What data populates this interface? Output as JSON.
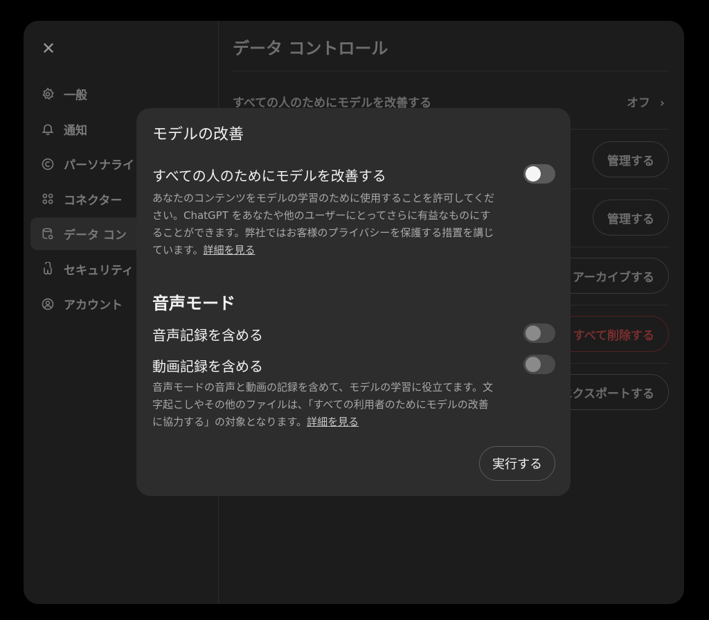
{
  "sidebar": {
    "close_glyph": "✕",
    "items": [
      {
        "label": "一般",
        "icon": "gear-icon"
      },
      {
        "label": "通知",
        "icon": "bell-icon"
      },
      {
        "label": "パーソナライ",
        "icon": "personalize-icon"
      },
      {
        "label": "コネクター",
        "icon": "connector-icon"
      },
      {
        "label": "データ コン",
        "icon": "database-icon"
      },
      {
        "label": "セキュリティ",
        "icon": "shield-icon"
      },
      {
        "label": "アカウント",
        "icon": "account-icon"
      }
    ]
  },
  "main": {
    "title": "データ コントロール",
    "improve_row": {
      "label": "すべての人のためにモデルを改善する",
      "value": "オフ",
      "chevron": "›"
    },
    "buttons": {
      "manage_1": "管理する",
      "manage_2": "管理する",
      "archive": "アーカイブする",
      "delete": "すべて削除する",
      "export": "エクスポートする"
    }
  },
  "modal": {
    "title": "モデルの改善",
    "improve": {
      "title": "すべての人のためにモデルを改善する",
      "description": "あなたのコンテンツをモデルの学習のために使用することを許可してください。ChatGPT をあなたや他のユーザーにとってさらに有益なものにすることができます。弊社ではお客様のプライバシーを保護する措置を講じています。",
      "link": "詳細を見る",
      "enabled": false
    },
    "voice": {
      "heading": "音声モード",
      "audio_label": "音声記録を含める",
      "audio_enabled": false,
      "video_label": "動画記録を含める",
      "video_enabled": false,
      "description": "音声モードの音声と動画の記録を含めて、モデルの学習に役立てます。文字起こしやその他のファイルは、「すべての利用者のためにモデルの改善に協力する」の対象となります。",
      "link": "詳細を見る"
    },
    "run_button": "実行する"
  }
}
